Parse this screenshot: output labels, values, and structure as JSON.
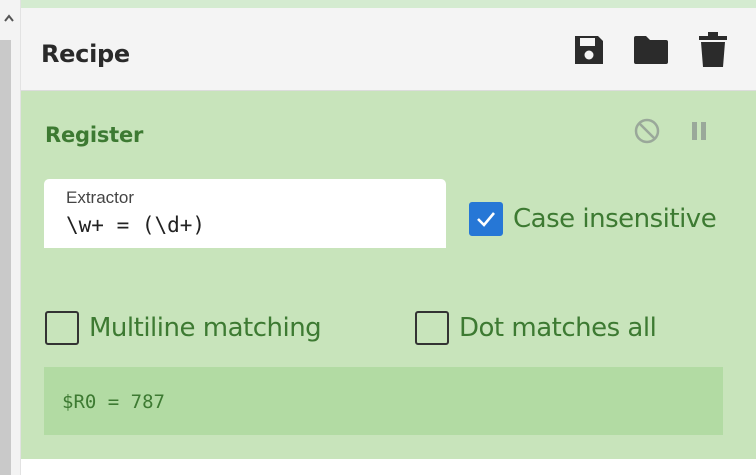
{
  "recipe": {
    "title": "Recipe",
    "icons": [
      "save-icon",
      "folder-icon",
      "trash-icon"
    ]
  },
  "operation": {
    "title": "Register",
    "controls": [
      "disable-icon",
      "pause-icon"
    ],
    "extractor": {
      "label": "Extractor",
      "value": "\\w+ = (\\d+)"
    },
    "case_insensitive": {
      "label": "Case insensitive",
      "checked": true
    },
    "multiline": {
      "label": "Multiline matching",
      "checked": false
    },
    "dot_all": {
      "label": "Dot matches all",
      "checked": false
    },
    "output": "$R0 = 787"
  },
  "colors": {
    "op_bg": "#c8e4bb",
    "op_title": "#3d7a32",
    "checkbox_checked": "#2677d6",
    "output_bg": "#b2dba3"
  }
}
